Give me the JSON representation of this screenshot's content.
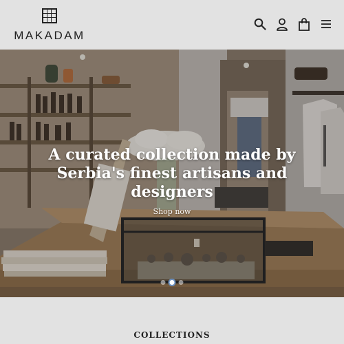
{
  "brand": {
    "name": "MAKADAM"
  },
  "header": {
    "icons": [
      "search-icon",
      "account-icon",
      "cart-icon",
      "menu-icon"
    ]
  },
  "hero": {
    "title": "A curated collection made by Serbia's finest artisans and designers",
    "link_label": "Shop now",
    "slides": 3,
    "active_slide": 2
  },
  "sections": {
    "collections_title": "COLLECTIONS"
  }
}
